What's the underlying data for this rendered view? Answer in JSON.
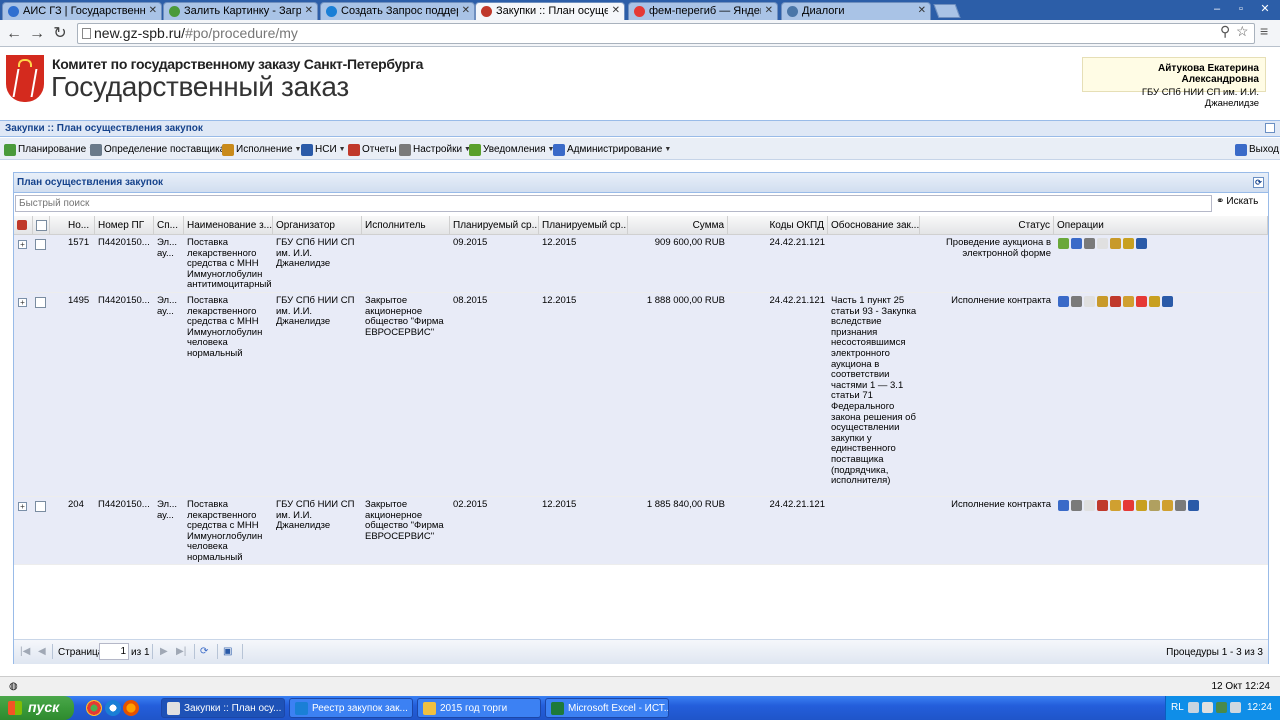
{
  "browser": {
    "tabs": [
      {
        "label": "АИС ГЗ | Государственный",
        "favicon_color": "#2f6fd0"
      },
      {
        "label": "Залить Картинку - Загрузи",
        "favicon_color": "#4b9a3a"
      },
      {
        "label": "Создать Запрос поддержк",
        "favicon_color": "#1a7fd6"
      },
      {
        "label": "Закупки :: План осуществл",
        "favicon_color": "#c0392b"
      },
      {
        "label": "фем-перегиб — Яндекс: на",
        "favicon_color": "#e53935"
      },
      {
        "label": "Диалоги",
        "favicon_color": "#4a76a8"
      }
    ],
    "url_host": "new.gz-spb.ru/",
    "url_path": "#po/procedure/my"
  },
  "header": {
    "org_name": "Комитет по государственному заказу Санкт-Петербурга",
    "site_title": "Государственный заказ",
    "user_name": "Айтукова Екатерина Александровна",
    "user_org": "ГБУ СПб НИИ СП им. И.И. Джанелидзе"
  },
  "breadcrumb": "Закупки :: План осуществления закупок",
  "menu": [
    {
      "label": "Планирование",
      "icon_color": "#4a9a3a",
      "arrow": true
    },
    {
      "label": "Определение поставщика",
      "icon_color": "#6a7a8a",
      "arrow": true
    },
    {
      "label": "Исполнение",
      "icon_color": "#c98a1a",
      "arrow": true
    },
    {
      "label": "НСИ",
      "icon_color": "#2a5aa8",
      "arrow": true
    },
    {
      "label": "Отчеты",
      "icon_color": "#c0392b",
      "arrow": false
    },
    {
      "label": "Настройки",
      "icon_color": "#7a7a7a",
      "arrow": true
    },
    {
      "label": "Уведомления",
      "icon_color": "#5aa02c",
      "arrow": true
    },
    {
      "label": "Администрирование",
      "icon_color": "#3a6ac8",
      "arrow": true
    }
  ],
  "exit_label": "Выход",
  "panel": {
    "title": "План осуществления закупок",
    "search_placeholder": "Быстрый поиск",
    "search_button": "Искать",
    "columns": [
      "Но...",
      "Номер ПГ",
      "Сп...",
      "Наименование з...",
      "Организатор",
      "Исполнитель",
      "Планируемый ср...",
      "Планируемый ср...",
      "Сумма",
      "Коды ОКПД",
      "Обоснование зак...",
      "Статус",
      "Операции"
    ],
    "rows": [
      {
        "num": "1571",
        "pg": "П4420150...",
        "sp": "Эл... ау...",
        "name": "Поставка лекарственного средства с МНН Иммуноглобулин антитимоцитарный",
        "organizer": "ГБУ СПб НИИ СП им. И.И. Джанелидзе",
        "executor": "",
        "date1": "09.2015",
        "date2": "12.2015",
        "sum": "909 600,00 RUB",
        "okpd": "24.42.21.121",
        "reason": "",
        "status": "Проведение аукциона в электронной форме",
        "ops": [
          "#6aa83a",
          "#3a6ac8",
          "#7a7a7a",
          "#e0e0e0",
          "#c89a2a",
          "#c8a020",
          "#2a5aa8"
        ]
      },
      {
        "num": "1495",
        "pg": "П4420150...",
        "sp": "Эл... ау...",
        "name": "Поставка лекарственного средства с МНН Иммуноглобулин человека нормальный",
        "organizer": "ГБУ СПб НИИ СП им. И.И. Джанелидзе",
        "executor": "Закрытое акционерное общество \"Фирма ЕВРОСЕРВИС\"",
        "date1": "08.2015",
        "date2": "12.2015",
        "sum": "1 888 000,00 RUB",
        "okpd": "24.42.21.121",
        "reason": "Часть 1 пункт 25 статьи 93 - Закупка вследствие признания несостоявшимся электронного аукциона в соответствии частями 1 — 3.1 статьи 71 Федерального закона решения об осуществлении закупки у единственного поставщика (подрядчика, исполнителя)",
        "status": "Исполнение контракта",
        "ops": [
          "#3a6ac8",
          "#7a7a7a",
          "#e0e0e0",
          "#c89a2a",
          "#c0392b",
          "#d0a030",
          "#e53935",
          "#c8a020",
          "#2a5aa8"
        ]
      },
      {
        "num": "204",
        "pg": "П4420150...",
        "sp": "Эл... ау...",
        "name": "Поставка лекарственного средства с МНН Иммуноглобулин человека нормальный",
        "organizer": "ГБУ СПб НИИ СП им. И.И. Джанелидзе",
        "executor": "Закрытое акционерное общество \"Фирма ЕВРОСЕРВИС\"",
        "date1": "02.2015",
        "date2": "12.2015",
        "sum": "1 885 840,00 RUB",
        "okpd": "24.42.21.121",
        "reason": "",
        "status": "Исполнение контракта",
        "ops": [
          "#3a6ac8",
          "#7a7a7a",
          "#e0e0e0",
          "#c0392b",
          "#d0a030",
          "#e53935",
          "#c8a020",
          "#b0a060",
          "#d0a030",
          "#7a7a7a",
          "#2a5aa8"
        ]
      }
    ],
    "pager": {
      "page_label": "Страница",
      "page_value": "1",
      "of_label": "из 1",
      "summary": "Процедуры 1 - 3 из 3"
    }
  },
  "status_date": "12 Окт 12:24",
  "taskbar": {
    "start_label": "пуск",
    "tasks": [
      {
        "label": "Закупки :: План осу...",
        "icon_color": "#e0e0e0"
      },
      {
        "label": "Реестр закупок зак...",
        "icon_color": "#1a7fd6"
      },
      {
        "label": "2015 год торги",
        "icon_color": "#f0c040"
      },
      {
        "label": "Microsoft Excel - ИСТ...",
        "icon_color": "#1e7a3a"
      }
    ],
    "lang": "RL",
    "time": "12:24"
  },
  "colors": {
    "accent": "#15428b",
    "row_bg": "#e8ebf7",
    "taskbar": "#245edb"
  }
}
